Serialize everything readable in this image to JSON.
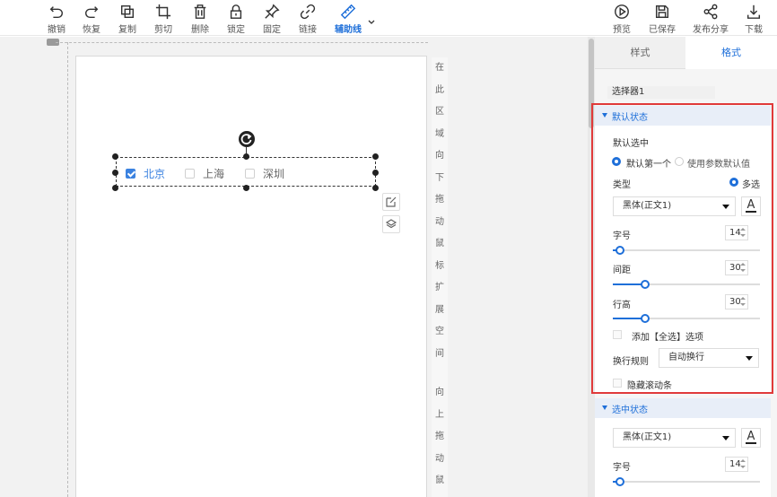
{
  "toolbar": {
    "undo": "撤销",
    "redo": "恢复",
    "copy": "复制",
    "cut": "剪切",
    "delete": "删除",
    "lock": "锁定",
    "pin": "固定",
    "link": "链接",
    "guide": "辅助线",
    "preview": "预览",
    "save": "已保存",
    "share": "发布分享",
    "download": "下载"
  },
  "side_strip": {
    "top_chars": [
      "在",
      "此",
      "区",
      "域",
      "向",
      "下",
      "拖",
      "动",
      "鼠",
      "标",
      "扩",
      "展",
      "空",
      "间"
    ],
    "bottom_chars": [
      "向",
      "上",
      "拖",
      "动",
      "鼠"
    ]
  },
  "widget": {
    "options": [
      {
        "label": "北京",
        "checked": true
      },
      {
        "label": "上海",
        "checked": false
      },
      {
        "label": "深圳",
        "checked": false
      }
    ]
  },
  "panel": {
    "tabs": {
      "style": "样式",
      "format": "格式"
    },
    "selector_name": "选择器1",
    "default_section": {
      "title": "默认状态",
      "default_selected_label": "默认选中",
      "radio_first": "默认第一个",
      "radio_param": "使用参数默认值",
      "type_label": "类型",
      "type_value": "多选",
      "font": "黑体(正文1)",
      "font_color_glyph": "A",
      "font_size_label": "字号",
      "font_size": "14",
      "font_size_level": 0.05,
      "spacing_label": "间距",
      "spacing": "30",
      "spacing_level": 0.22,
      "line_height_label": "行高",
      "line_height": "30",
      "line_height_level": 0.22,
      "add_all_label": "添加【全选】选项",
      "wrap_label": "换行规则",
      "wrap_value": "自动换行",
      "hide_scroll_label": "隐藏滚动条"
    },
    "selected_section": {
      "title": "选中状态",
      "font": "黑体(正文1)",
      "font_color_glyph": "A",
      "font_size_label": "字号",
      "font_size": "14",
      "font_size_level": 0.05
    }
  },
  "colors": {
    "accent": "#1e6fd9",
    "highlight": "#e03a3a",
    "checked": "#3b82e0"
  }
}
